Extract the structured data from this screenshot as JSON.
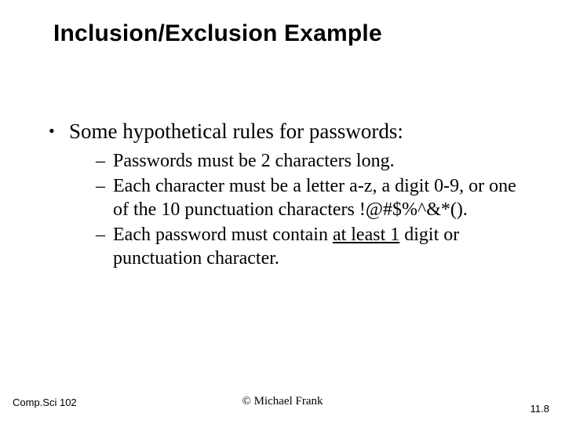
{
  "title": "Inclusion/Exclusion Example",
  "bullet": {
    "text": "Some hypothetical rules for passwords:"
  },
  "sub": {
    "item1": "Passwords must be 2 characters long.",
    "item2": "Each character must be a letter a-z, a digit 0-9, or one of the 10 punctuation characters !@#$%^&*().",
    "item3_prefix": "Each password must contain ",
    "item3_underlined": "at least 1",
    "item3_suffix": " digit or punctuation character."
  },
  "footer": {
    "left": "Comp.Sci 102",
    "center": "© Michael Frank",
    "right": "11.8"
  }
}
